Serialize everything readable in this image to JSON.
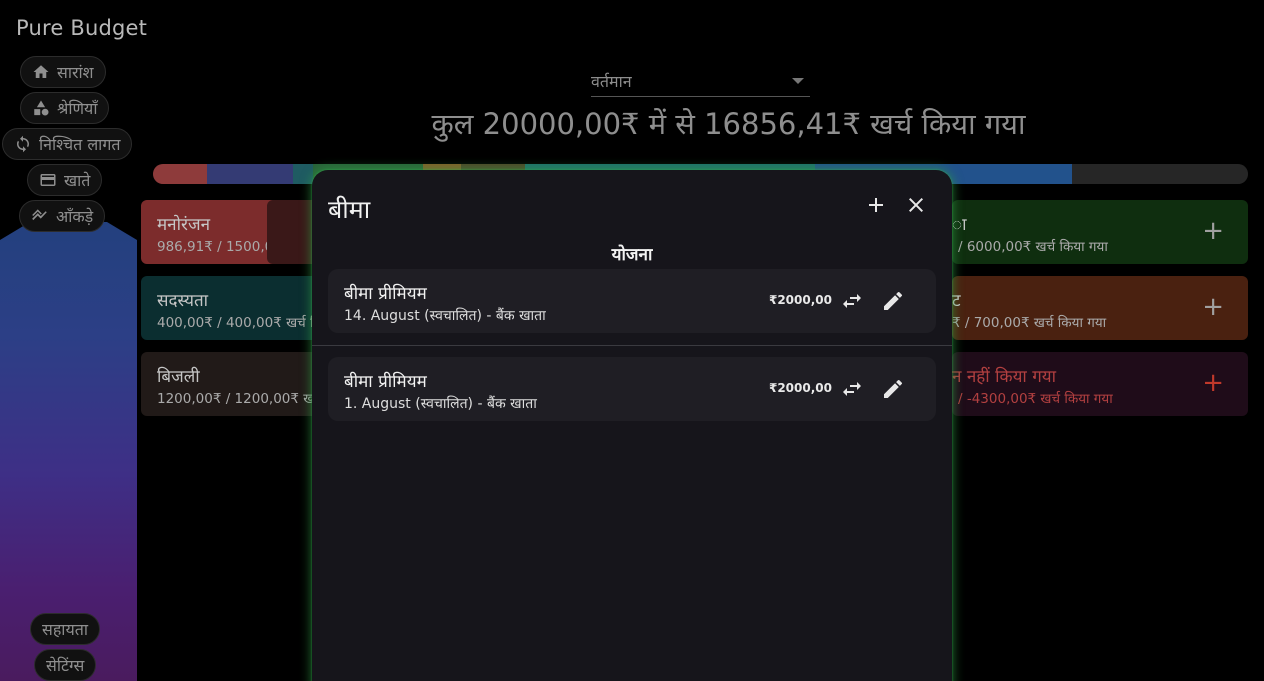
{
  "app": {
    "title": "Pure Budget"
  },
  "sidebar": {
    "items": [
      {
        "label": "सारांश",
        "icon": "home-icon"
      },
      {
        "label": "श्रेणियाँ",
        "icon": "shapes-icon"
      },
      {
        "label": "निश्चित लागत",
        "icon": "repeat-icon"
      },
      {
        "label": "खाते",
        "icon": "wallet-icon"
      },
      {
        "label": "आँकड़े",
        "icon": "stats-icon"
      }
    ],
    "footer": [
      {
        "label": "सहायता"
      },
      {
        "label": "सेटिंग्स"
      }
    ]
  },
  "main": {
    "period": {
      "value": "वर्तमान"
    },
    "total_text": "कुल 20000,00₹ में से 16856,41₹ खर्च किया गया",
    "budget_bar_colors": [
      "#d44a4a",
      "#3e4aa8",
      "#1b7e8a",
      "#2b8a46",
      "#c5832b",
      "#6b5a2a",
      "#1aa19b",
      "#1f6fd0",
      "#272727"
    ],
    "cards_left": [
      {
        "name": "मनोरंजन",
        "spent": "986,91₹ / 1500,00₹ खर्च कि",
        "color": "#a23a3a"
      },
      {
        "name": "सदस्यता",
        "spent": "400,00₹ / 400,00₹ खर्च कि",
        "color": "#0f3a3c"
      },
      {
        "name": "बिजली",
        "spent": "1200,00₹ / 1200,00₹ खर्च",
        "color": "#2b2220"
      }
    ],
    "cards_right": [
      {
        "name": "ा",
        "spent": "/ 6000,00₹ खर्च किया गया",
        "color": "#123d12",
        "plus": "+"
      },
      {
        "name": "ट",
        "spent": "₹ / 700,00₹ खर्च किया गया",
        "color": "#5d2a14",
        "plus": "+"
      },
      {
        "name": "न नहीं किया गया",
        "spent": "/ -4300,00₹ खर्च किया गया",
        "color": "#27101f",
        "plus": "+"
      }
    ]
  },
  "modal": {
    "title": "बीमा",
    "section_title": "योजना",
    "plans": [
      {
        "name": "बीमा प्रीमियम",
        "details": "14. August (स्वचालित) - बैंक खाता",
        "amount": "₹2000,00"
      },
      {
        "name": "बीमा प्रीमियम",
        "details": "1. August (स्वचालित) - बैंक खाता",
        "amount": "₹2000,00"
      }
    ]
  }
}
